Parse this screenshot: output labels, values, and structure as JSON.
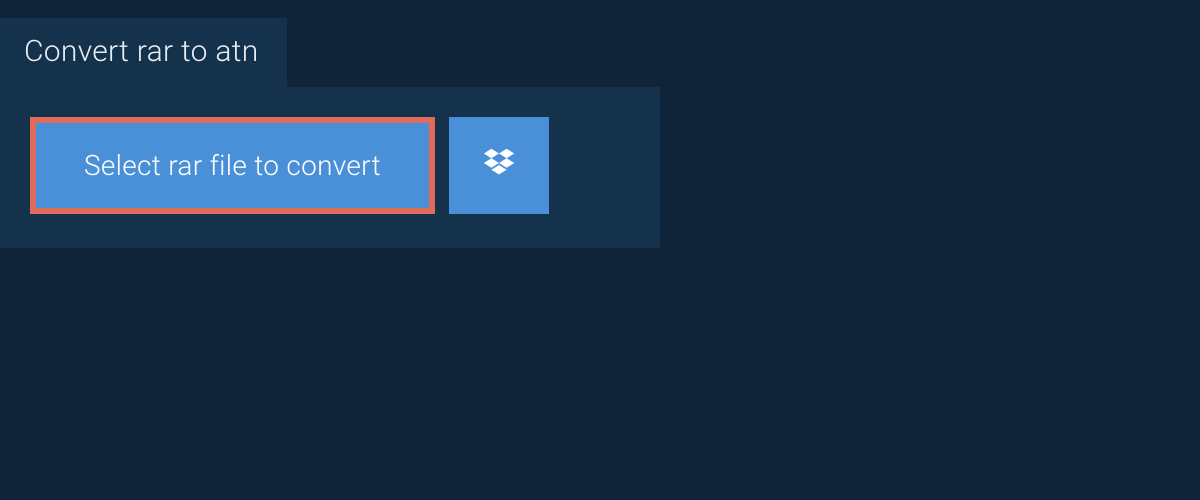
{
  "tab": {
    "title": "Convert rar to atn"
  },
  "panel": {
    "select_button_label": "Select rar file to convert",
    "highlight_color": "#e16a5a",
    "button_color": "#4a90d9"
  },
  "icons": {
    "dropbox": "dropbox-icon"
  }
}
